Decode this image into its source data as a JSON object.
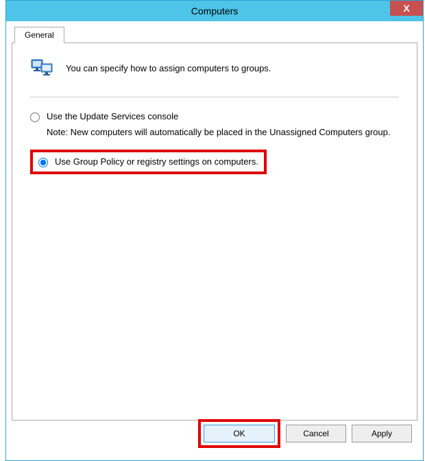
{
  "window": {
    "title": "Computers",
    "close_glyph": "X"
  },
  "tab": {
    "label": "General"
  },
  "intro": {
    "text": "You can specify how to assign computers to groups."
  },
  "options": {
    "opt1": {
      "label": "Use the Update Services console",
      "note": "Note: New computers will automatically be placed in the Unassigned Computers group."
    },
    "opt2": {
      "label": "Use Group Policy or registry settings on computers."
    },
    "selected": "opt2"
  },
  "buttons": {
    "ok": "OK",
    "cancel": "Cancel",
    "apply": "Apply"
  }
}
